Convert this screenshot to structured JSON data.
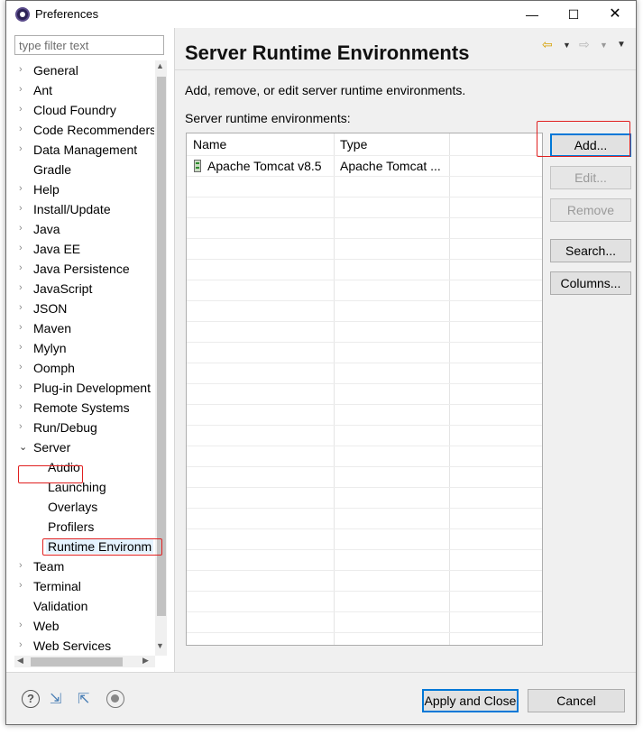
{
  "window": {
    "title": "Preferences",
    "minimize": "—",
    "maximize": "☐",
    "close": "✕"
  },
  "filter": {
    "placeholder": "type filter text"
  },
  "tree": {
    "items": [
      {
        "label": "General",
        "chevron": "›"
      },
      {
        "label": "Ant",
        "chevron": "›"
      },
      {
        "label": "Cloud Foundry",
        "chevron": "›"
      },
      {
        "label": "Code Recommenders",
        "chevron": "›"
      },
      {
        "label": "Data Management",
        "chevron": "›"
      },
      {
        "label": "Gradle",
        "chevron": ""
      },
      {
        "label": "Help",
        "chevron": "›"
      },
      {
        "label": "Install/Update",
        "chevron": "›"
      },
      {
        "label": "Java",
        "chevron": "›"
      },
      {
        "label": "Java EE",
        "chevron": "›"
      },
      {
        "label": "Java Persistence",
        "chevron": "›"
      },
      {
        "label": "JavaScript",
        "chevron": "›"
      },
      {
        "label": "JSON",
        "chevron": "›"
      },
      {
        "label": "Maven",
        "chevron": "›"
      },
      {
        "label": "Mylyn",
        "chevron": "›"
      },
      {
        "label": "Oomph",
        "chevron": "›"
      },
      {
        "label": "Plug-in Development",
        "chevron": "›"
      },
      {
        "label": "Remote Systems",
        "chevron": "›"
      },
      {
        "label": "Run/Debug",
        "chevron": "›"
      },
      {
        "label": "Server",
        "chevron": "⌄"
      },
      {
        "label": "Audio",
        "chevron": ""
      },
      {
        "label": "Launching",
        "chevron": ""
      },
      {
        "label": "Overlays",
        "chevron": ""
      },
      {
        "label": "Profilers",
        "chevron": ""
      },
      {
        "label": "Runtime Environm",
        "chevron": ""
      },
      {
        "label": "Team",
        "chevron": "›"
      },
      {
        "label": "Terminal",
        "chevron": "›"
      },
      {
        "label": "Validation",
        "chevron": ""
      },
      {
        "label": "Web",
        "chevron": "›"
      },
      {
        "label": "Web Services",
        "chevron": "›"
      }
    ]
  },
  "page": {
    "title": "Server Runtime Environments",
    "description": "Add, remove, or edit server runtime environments.",
    "list_label": "Server runtime environments:"
  },
  "nav": {
    "back": "⇦",
    "back_dropdown": "▼",
    "forward": "⇨",
    "forward_dropdown": "▼",
    "menu": "▼"
  },
  "table": {
    "columns": [
      "Name",
      "Type"
    ],
    "rows": [
      {
        "name": "Apache Tomcat v8.5",
        "type": "Apache Tomcat ..."
      }
    ]
  },
  "buttons": {
    "add": "Add...",
    "edit": "Edit...",
    "remove": "Remove",
    "search": "Search...",
    "columns": "Columns..."
  },
  "footer": {
    "help": "?",
    "import": "⇲",
    "export": "⇱",
    "apply_close": "Apply and Close",
    "cancel": "Cancel"
  },
  "scroll": {
    "up": "▲",
    "down": "▼",
    "left": "◀",
    "right": "▶"
  },
  "colors": {
    "highlight": "#e02020",
    "selection": "#e5f3ff",
    "primary_border": "#0078d7"
  }
}
